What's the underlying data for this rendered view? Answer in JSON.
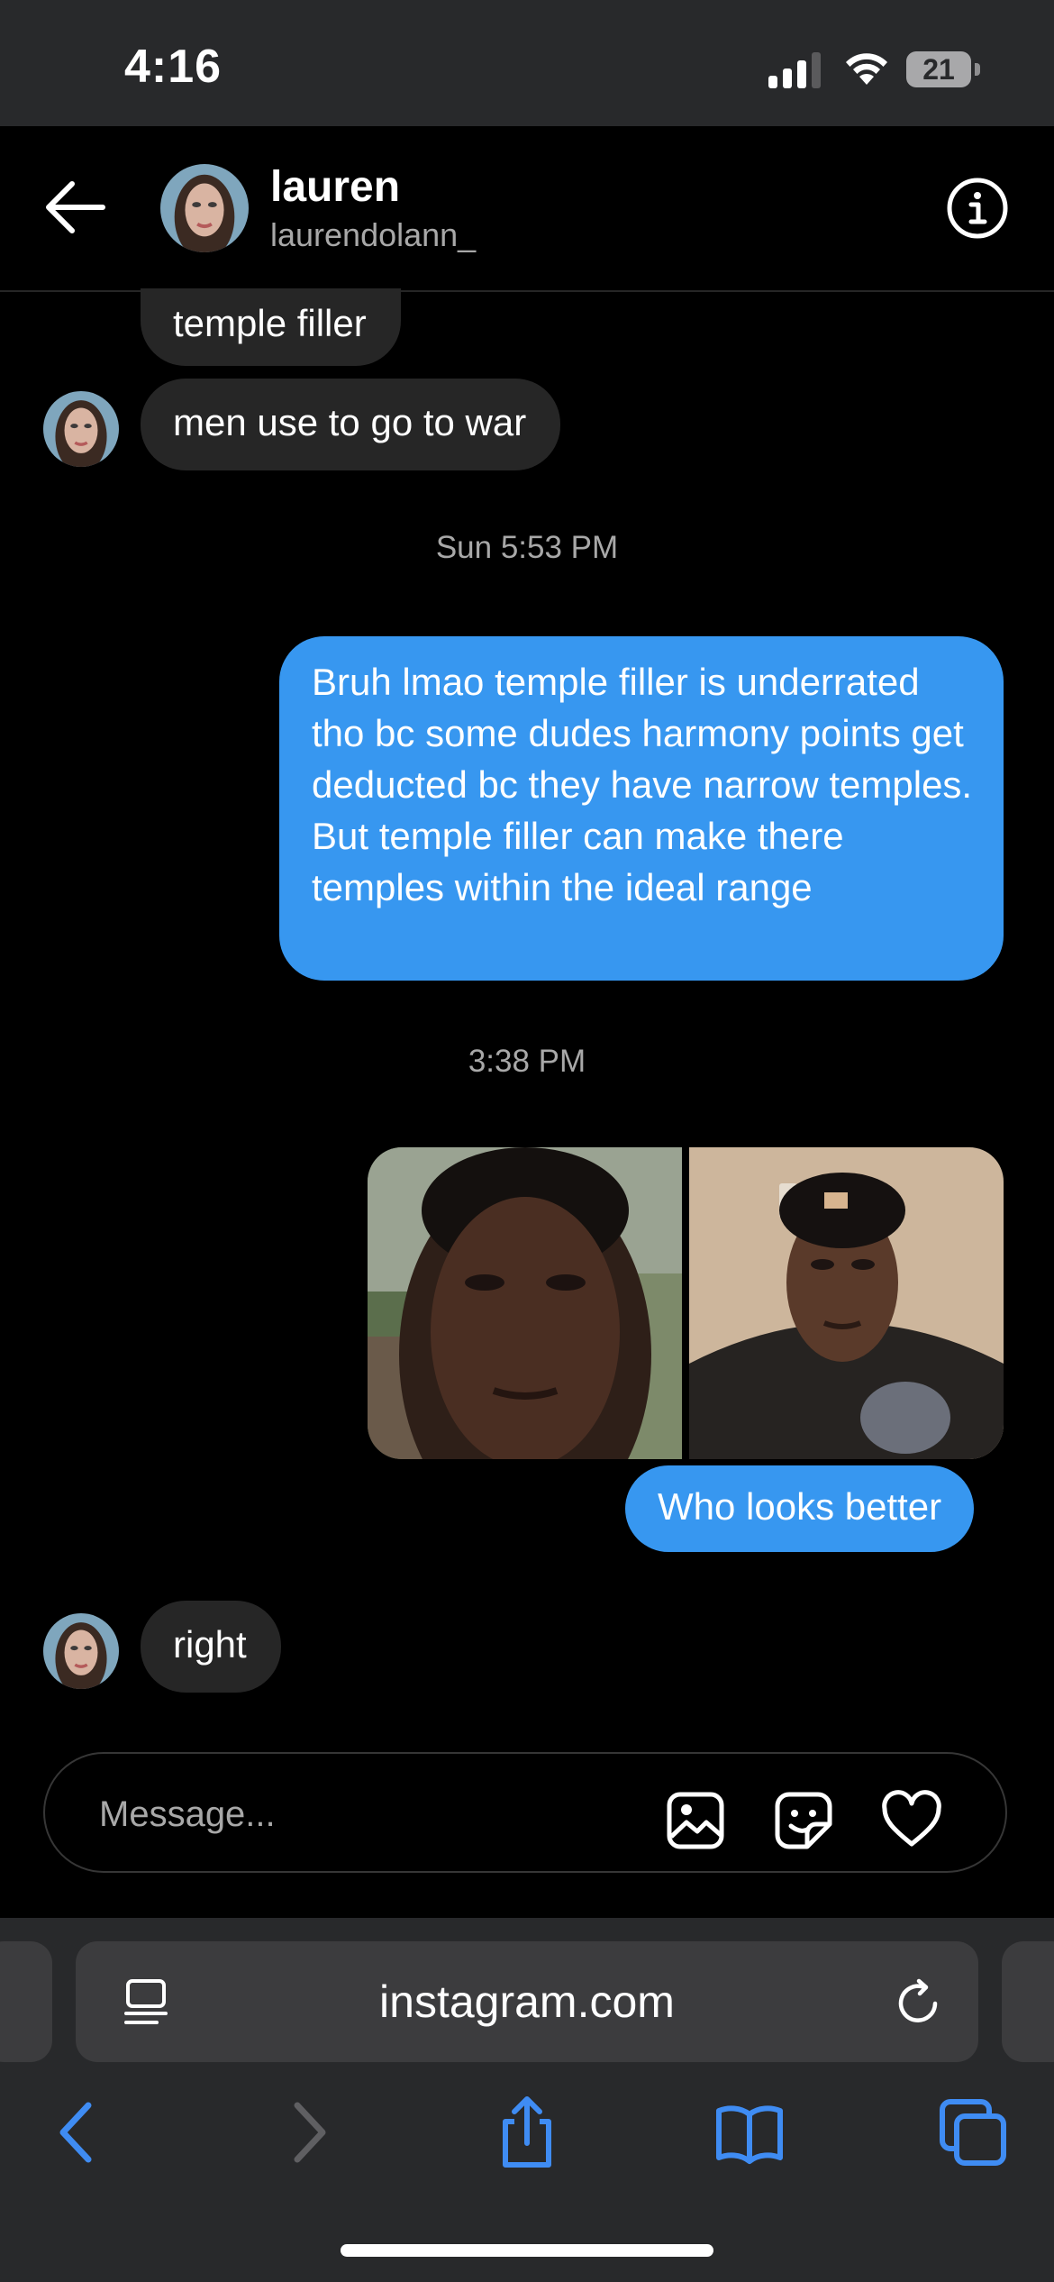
{
  "status_bar": {
    "time": "4:16",
    "battery": "21"
  },
  "header": {
    "name": "lauren",
    "handle": "laurendolann_"
  },
  "messages": {
    "incoming_1": "temple filler",
    "incoming_2": "men use to go to war",
    "timestamp_1": "Sun 5:53 PM",
    "outgoing_1": "Bruh lmao temple filler is underrated tho bc some dudes harmony points get deducted bc they have narrow temples. But temple filler can make there temples within the ideal range",
    "timestamp_2": "3:38 PM",
    "outgoing_2": "Who looks better",
    "incoming_3": "right"
  },
  "composer": {
    "placeholder": "Message..."
  },
  "browser": {
    "url": "instagram.com"
  },
  "colors": {
    "outgoing_bubble": "#3797f0",
    "incoming_bubble": "#262626",
    "browser_accent": "#3f8cf3",
    "status_bar_bg": "#28292b"
  },
  "icons": {
    "header": [
      "back-arrow-icon",
      "info-icon"
    ],
    "composer": [
      "image-icon",
      "sticker-icon",
      "heart-icon"
    ],
    "browser": [
      "reader-icon",
      "reload-icon",
      "back-icon",
      "forward-icon",
      "share-icon",
      "bookmarks-icon",
      "tabs-icon"
    ]
  }
}
